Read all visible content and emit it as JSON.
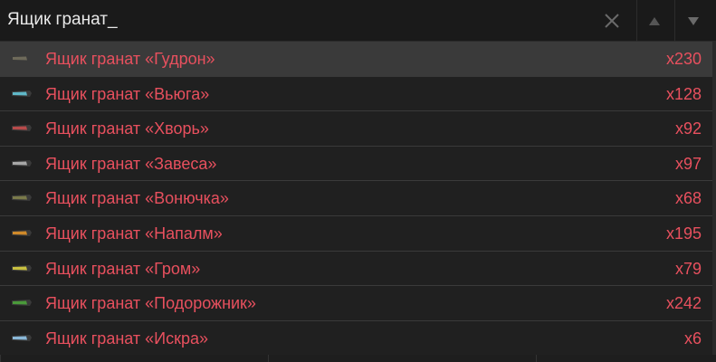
{
  "search": {
    "value": "Ящик гранат_",
    "clear_icon": "close-icon",
    "prev_icon": "triangle-up-icon",
    "next_icon": "triangle-down-icon"
  },
  "results": [
    {
      "name": "Ящик гранат «Гудрон»",
      "count": "x230",
      "icon_color": "#6e6a5a",
      "selected": true
    },
    {
      "name": "Ящик гранат «Вьюга»",
      "count": "x128",
      "icon_color": "#5fb8c8",
      "selected": false
    },
    {
      "name": "Ящик гранат «Хворь»",
      "count": "x92",
      "icon_color": "#b84a4a",
      "selected": false
    },
    {
      "name": "Ящик гранат «Завеса»",
      "count": "x97",
      "icon_color": "#a8a8a8",
      "selected": false
    },
    {
      "name": "Ящик гранат «Вонючка»",
      "count": "x68",
      "icon_color": "#7a7a4a",
      "selected": false
    },
    {
      "name": "Ящик гранат «Напалм»",
      "count": "x195",
      "icon_color": "#d08a2a",
      "selected": false
    },
    {
      "name": "Ящик гранат «Гром»",
      "count": "x79",
      "icon_color": "#c8c040",
      "selected": false
    },
    {
      "name": "Ящик гранат «Подорожник»",
      "count": "x242",
      "icon_color": "#4a9a3a",
      "selected": false
    },
    {
      "name": "Ящик гранат «Искра»",
      "count": "x6",
      "icon_color": "#8ab8d8",
      "selected": false
    }
  ],
  "colors": {
    "item_text": "#e8505e",
    "selected_row": "#3a3a3a",
    "row_bg": "#202020"
  }
}
